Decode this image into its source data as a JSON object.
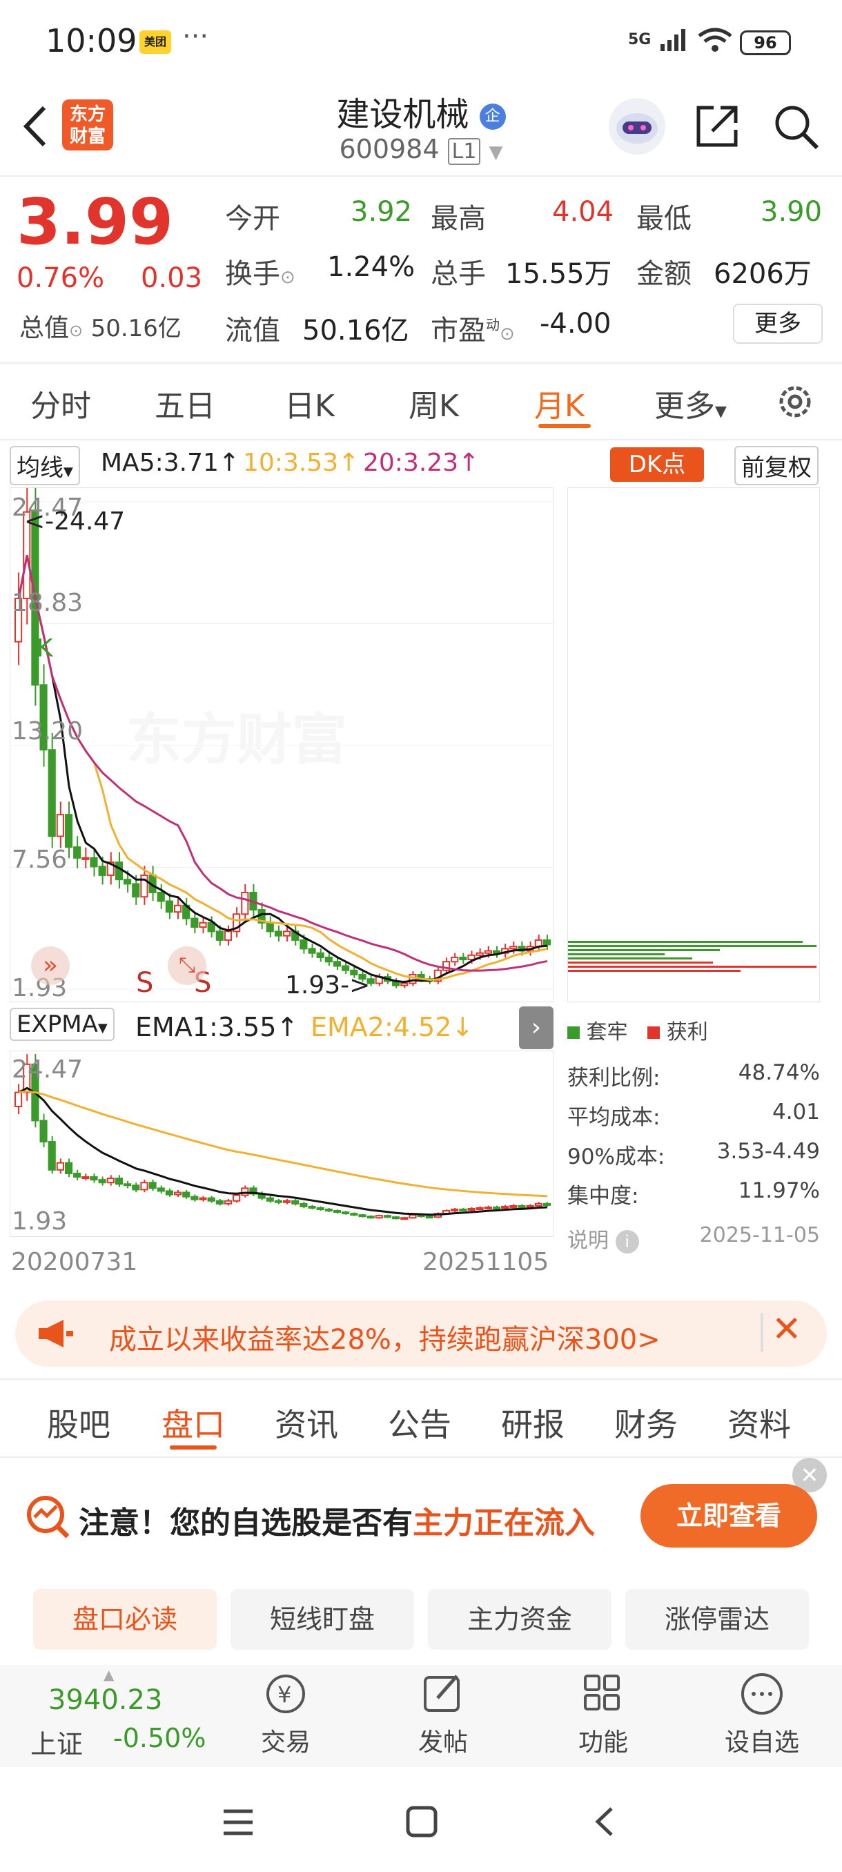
{
  "status_bar": {
    "time": "10:09",
    "app_badge": "美团",
    "dots": "···",
    "network": "5G",
    "battery": "96"
  },
  "header": {
    "logo_text": "东方\n财富",
    "stock_name": "建设机械",
    "badge": "企",
    "code": "600984",
    "level": "L1"
  },
  "quote": {
    "price": "3.99",
    "change_pct": "0.76%",
    "change": "0.03",
    "open_label": "今开",
    "open": "3.92",
    "high_label": "最高",
    "high": "4.04",
    "low_label": "最低",
    "low": "3.90",
    "turnover_label": "换手",
    "turnover": "1.24%",
    "volume_label": "总手",
    "volume": "15.55万",
    "amount_label": "金额",
    "amount": "6206万",
    "mktcap_label": "总值",
    "mktcap": "50.16亿",
    "float_label": "流值",
    "float": "50.16亿",
    "pe_label": "市盈",
    "pe_sup": "动",
    "pe": "-4.00",
    "more": "更多"
  },
  "chart_tabs": [
    "分时",
    "五日",
    "日K",
    "周K",
    "月K",
    "更多"
  ],
  "active_tab": "月K",
  "indicators": {
    "ma_selector": "均线",
    "ma5": "MA5:3.71↑",
    "ma10": "10:3.53↑",
    "ma20": "20:3.23↑",
    "dk_button": "DK点",
    "adjust": "前复权",
    "expma_selector": "EXPMA",
    "ema1": "EMA1:3.55↑",
    "ema2": "EMA2:4.52↓"
  },
  "chart_data": {
    "type": "candlestick",
    "period": "月K",
    "x_start": "20200731",
    "x_end": "20251105",
    "ytick_labels": [
      "24.47",
      "18.83",
      "13.20",
      "7.56",
      "1.93"
    ],
    "max_marker": "<-24.47",
    "min_marker": "1.93->",
    "k_marker": "K",
    "s_markers": [
      "S",
      "S"
    ],
    "watermark": "东方财富",
    "lower_ytick_labels": [
      "24.47",
      "1.93"
    ]
  },
  "chip": {
    "legend_trap": "套牢",
    "legend_profit": "获利",
    "rows": [
      {
        "label": "获利比例:",
        "value": "48.74%"
      },
      {
        "label": "平均成本:",
        "value": "4.01"
      },
      {
        "label": "90%成本:",
        "value": "3.53-4.49"
      },
      {
        "label": "集中度:",
        "value": "11.97%"
      }
    ],
    "note": "说明",
    "date": "2025-11-05"
  },
  "banner": {
    "text": "成立以来收益率达28%，持续跑赢沪深300>"
  },
  "section_tabs": [
    "股吧",
    "盘口",
    "资讯",
    "公告",
    "研报",
    "财务",
    "资料"
  ],
  "active_section": "盘口",
  "alert": {
    "prefix": "注意！您的自选股是否有",
    "highlight": "主力正在流入",
    "button": "立即查看"
  },
  "sub_tabs": [
    "盘口必读",
    "短线盯盘",
    "主力资金",
    "涨停雷达"
  ],
  "bottom": {
    "index_value": "3940.23",
    "index_name": "上证",
    "index_change": "-0.50%",
    "items": [
      "交易",
      "发帖",
      "功能",
      "设自选"
    ]
  },
  "colors": {
    "up": "#e0342c",
    "down": "#3a9a2a",
    "accent": "#f06a1c",
    "ma10": "#f0b030",
    "ma20": "#c0307a"
  }
}
